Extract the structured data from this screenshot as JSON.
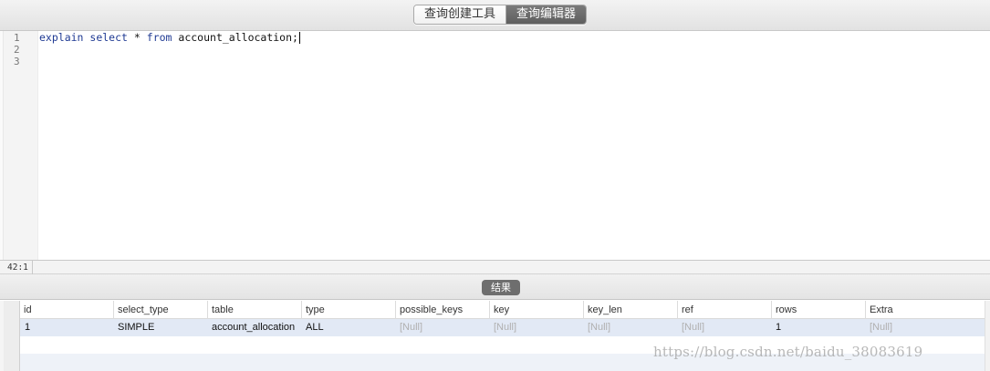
{
  "toolbar": {
    "tabs": [
      {
        "label": "查询创建工具",
        "active": false
      },
      {
        "label": "查询编辑器",
        "active": true
      }
    ]
  },
  "editor": {
    "line_numbers": [
      "1",
      "2",
      "3"
    ],
    "code": {
      "kw1": "explain",
      "kw2": "select",
      "star": "*",
      "kw3": "from",
      "table": "account_allocation;"
    }
  },
  "status": {
    "cursor_position": "42:1"
  },
  "results": {
    "tab_label": "结果",
    "columns": [
      "id",
      "select_type",
      "table",
      "type",
      "possible_keys",
      "key",
      "key_len",
      "ref",
      "rows",
      "Extra"
    ],
    "rows": [
      [
        "1",
        "SIMPLE",
        "account_allocation",
        "ALL",
        "[Null]",
        "[Null]",
        "[Null]",
        "[Null]",
        "1",
        "[Null]"
      ]
    ]
  },
  "watermark": "https://blog.csdn.net/baidu_38083619",
  "colors": {
    "keyword": "#1f3a93",
    "null_text": "#b0b0b0",
    "selected_row": "#e2e9f5",
    "active_tab": "#6e6e6e"
  }
}
